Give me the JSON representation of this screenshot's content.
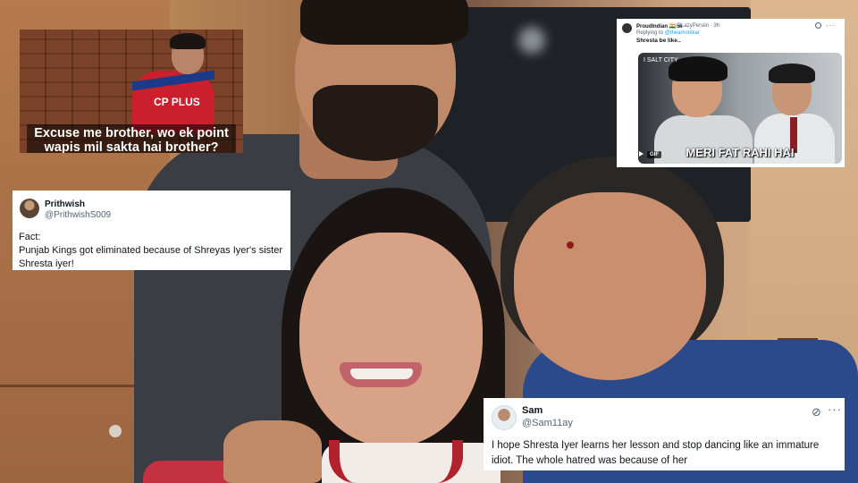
{
  "meme_top_left": {
    "caption_line1": "Excuse me brother, wo ek point",
    "caption_line2": "wapis mil sakta hai brother?",
    "sponsor_text": "CP PLUS"
  },
  "tweet_prithwish": {
    "name": "Prithwish",
    "handle": "@PrithwishS009",
    "body_line1": "Fact:",
    "body_line2": "Punjab Kings got eliminated because of Shreyas Iyer's sister",
    "body_line3": "Shresta iyer!"
  },
  "tweet_proudindian": {
    "name": "ProudIndian 🇮🇳 🕉",
    "handle": "@LazyPersiin · 3h",
    "replying_label": "Replying to",
    "replying_handle": "@theamonikar",
    "body": "Shresta be like..",
    "more_icon": "···",
    "gif": {
      "channel_tag": "I SALT CITY",
      "badge": "GIF",
      "caption": "MERI FAT RAHI HAI"
    }
  },
  "tweet_sam": {
    "name": "Sam",
    "handle": "@Sam11ay",
    "body": "I hope Shresta Iyer learns her lesson and stop dancing like an immature idiot. The whole hatred was because of her",
    "more_icon": "···",
    "grok_icon": "⊘"
  },
  "colors": {
    "twitter_text": "#0f1419",
    "twitter_secondary": "#536471",
    "twitter_link": "#1d9bf0",
    "jersey_red": "#cc1f2e"
  }
}
